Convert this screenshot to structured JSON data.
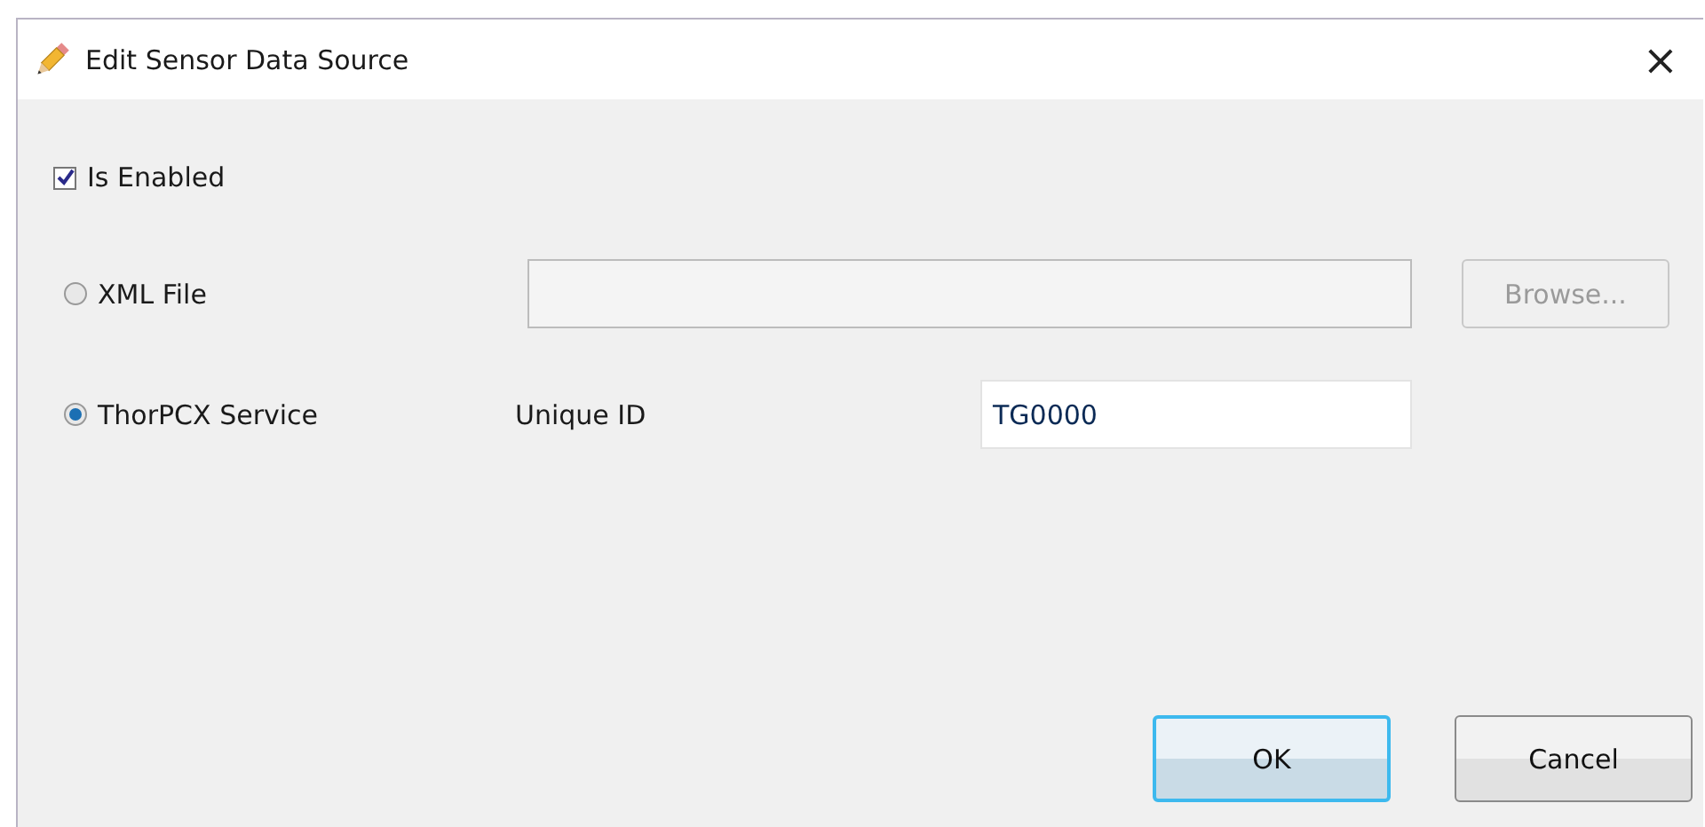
{
  "window": {
    "title": "Edit Sensor Data Source",
    "close": "×"
  },
  "enabled": {
    "label": "Is Enabled",
    "checked": true
  },
  "sources": [
    {
      "kind": "file",
      "label": "XML File",
      "selected": false,
      "button": {
        "label": "Browse...",
        "disabled": true
      }
    },
    {
      "kind": "service",
      "label": "ThorPCX Service",
      "selected": true,
      "field_label": "Unique ID",
      "value": "TG0000"
    }
  ],
  "buttons": [
    {
      "label": "OK",
      "default": true
    },
    {
      "label": "Cancel",
      "default": false
    }
  ]
}
